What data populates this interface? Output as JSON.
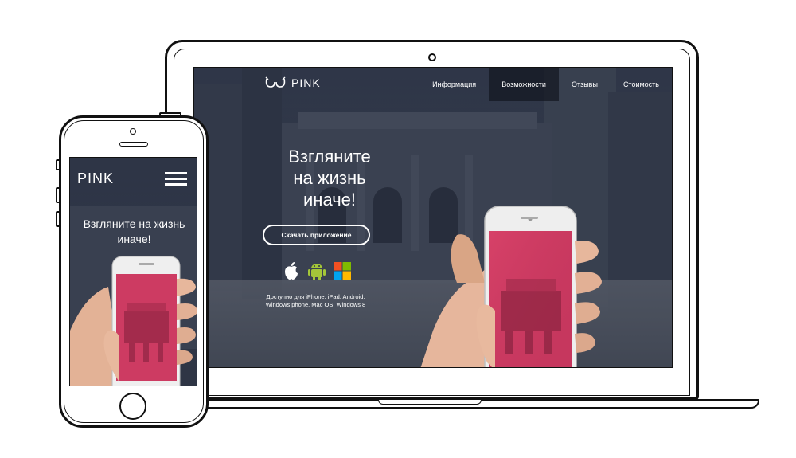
{
  "laptop": {
    "logo_text": "PINK",
    "nav": [
      "Информация",
      "Возможности",
      "Отзывы",
      "Стоимость"
    ],
    "nav_active_index": 1,
    "hero_title": [
      "Взгляните",
      "на жизнь",
      "иначе!"
    ],
    "download_label": "Скачать приложение",
    "platform_icons": [
      "apple-icon",
      "android-icon",
      "windows-icon"
    ],
    "available_text": [
      "Доступно для iPhone, iPad, Android,",
      "Windows phone, Mac OS, Windows 8"
    ]
  },
  "phone": {
    "logo_text": "PINK",
    "menu_icon": "hamburger-menu-icon",
    "hero_title": [
      "Взгляните на жизнь",
      "иначе!"
    ]
  },
  "colors": {
    "accent_pink": "#d8315b",
    "overlay_navy": "#242a3c",
    "outline": "#111111"
  }
}
